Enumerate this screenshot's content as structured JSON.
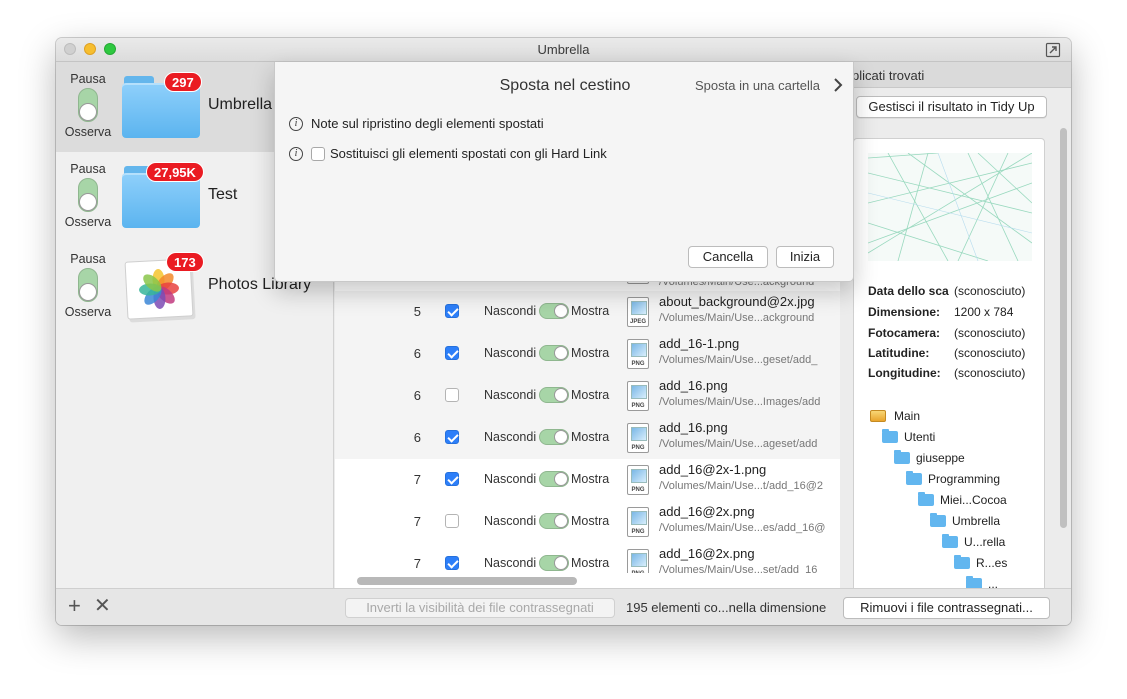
{
  "window": {
    "title": "Umbrella"
  },
  "sidebar": {
    "items": [
      {
        "pause": "Pausa",
        "watch": "Osserva",
        "badge": "297",
        "label": "Umbrella"
      },
      {
        "pause": "Pausa",
        "watch": "Osserva",
        "badge": "27,95K",
        "label": "Test"
      },
      {
        "pause": "Pausa",
        "watch": "Osserva",
        "badge": "173",
        "label": "Photos Library"
      }
    ]
  },
  "sheet": {
    "title": "Sposta nel cestino",
    "move_to_folder": "Sposta in una cartella",
    "note": "Note sul ripristino degli elementi spostati",
    "hardlink": "Sostituisci gli elementi spostati con gli Hard Link",
    "cancel": "Cancella",
    "start": "Inizia"
  },
  "table": {
    "rows": [
      {
        "num": "",
        "checked": false,
        "hide": "",
        "show": "",
        "name": "",
        "path": "/Volumes/Main/Use...ackground",
        "type": "JPEG"
      },
      {
        "num": "5",
        "checked": true,
        "hide": "Nascondi",
        "show": "Mostra",
        "name": "about_background@2x.jpg",
        "path": "/Volumes/Main/Use...ackground",
        "type": "JPEG"
      },
      {
        "num": "6",
        "checked": true,
        "hide": "Nascondi",
        "show": "Mostra",
        "name": "add_16-1.png",
        "path": "/Volumes/Main/Use...geset/add_",
        "type": "PNG"
      },
      {
        "num": "6",
        "checked": false,
        "hide": "Nascondi",
        "show": "Mostra",
        "name": "add_16.png",
        "path": "/Volumes/Main/Use...Images/add",
        "type": "PNG"
      },
      {
        "num": "6",
        "checked": true,
        "hide": "Nascondi",
        "show": "Mostra",
        "name": "add_16.png",
        "path": "/Volumes/Main/Use...ageset/add",
        "type": "PNG"
      },
      {
        "num": "7",
        "checked": true,
        "hide": "Nascondi",
        "show": "Mostra",
        "name": "add_16@2x-1.png",
        "path": "/Volumes/Main/Use...t/add_16@2",
        "type": "PNG"
      },
      {
        "num": "7",
        "checked": false,
        "hide": "Nascondi",
        "show": "Mostra",
        "name": "add_16@2x.png",
        "path": "/Volumes/Main/Use...es/add_16@",
        "type": "PNG"
      },
      {
        "num": "7",
        "checked": true,
        "hide": "Nascondi",
        "show": "Mostra",
        "name": "add_16@2x.png",
        "path": "/Volumes/Main/Use...set/add_16",
        "type": "PNG"
      }
    ]
  },
  "right": {
    "header": "plicati trovati",
    "tidy_button": "Gestisci il risultato in Tidy Up",
    "meta": [
      {
        "label": "Data dello sca",
        "value": "(sconosciuto)"
      },
      {
        "label": "Dimensione:",
        "value": "1200 x 784"
      },
      {
        "label": "Fotocamera:",
        "value": "(sconosciuto)"
      },
      {
        "label": "Latitudine:",
        "value": "(sconosciuto)"
      },
      {
        "label": "Longitudine:",
        "value": "(sconosciuto)"
      }
    ],
    "tree": [
      "Main",
      "Utenti",
      "giuseppe",
      "Programming",
      "Miei...Cocoa",
      "Umbrella",
      "U...rella",
      "R...es",
      "..."
    ]
  },
  "bottom": {
    "invert_button": "Inverti la visibilità dei file contrassegnati",
    "count": "195 elementi co...nella dimensione",
    "remove_button": "Rimuovi i file contrassegnati..."
  },
  "colors": {
    "accent": "#2d7ff9",
    "badge": "#ea1b22",
    "toggle": "#a7d5a7",
    "folder": "#62b6ef"
  }
}
